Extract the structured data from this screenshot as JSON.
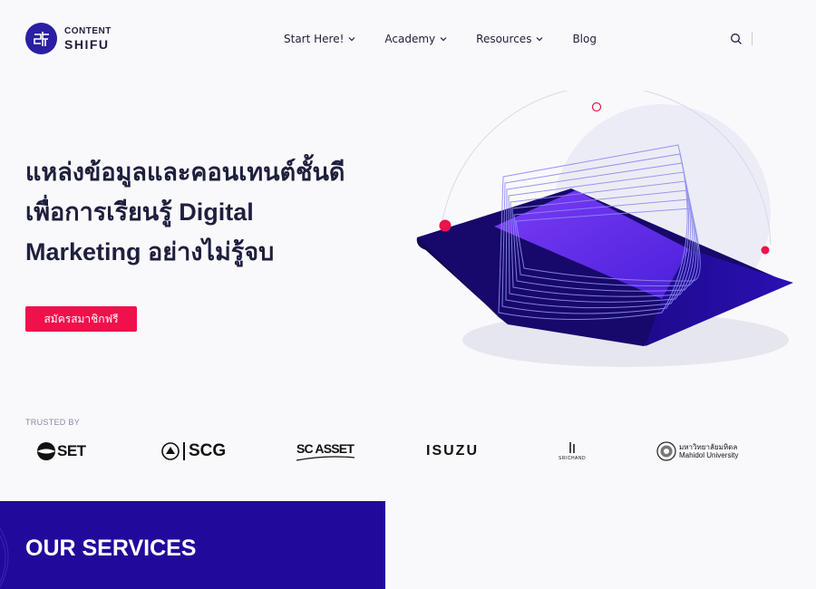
{
  "brand": {
    "logo_top": "CONTENT",
    "logo_bottom": "SHIFU",
    "icon": "content-shifu-logo-icon"
  },
  "nav": {
    "items": [
      {
        "label": "Start Here!",
        "has_dropdown": true
      },
      {
        "label": "Academy",
        "has_dropdown": true
      },
      {
        "label": "Resources",
        "has_dropdown": true
      },
      {
        "label": "Blog",
        "has_dropdown": false
      }
    ],
    "search_icon": "search-icon"
  },
  "hero": {
    "title_lines": [
      "แหล่งข้อมูลและคอนเทนต์ชั้นดี",
      "เพื่อการเรียนรู้ Digital",
      "Marketing อย่างไม่รู้จบ"
    ],
    "cta_label": "สมัครสมาชิกฟรี"
  },
  "trusted": {
    "label": "TRUSTED BY",
    "logos": [
      {
        "name": "SET",
        "text": "SET"
      },
      {
        "name": "SCG",
        "text": "SCG"
      },
      {
        "name": "SC ASSET",
        "text": "SC ASSET"
      },
      {
        "name": "ISUZU",
        "text": "ISUZU"
      },
      {
        "name": "SRICHAND",
        "text": "SRICHAND"
      },
      {
        "name": "Mahidol University",
        "text_th": "มหาวิทยาลัยมหิดล",
        "text_en": "Mahidol University"
      }
    ]
  },
  "services": {
    "title": "OUR SERVICES"
  },
  "colors": {
    "accent": "#f0104b",
    "brand_blue": "#21099b",
    "text": "#1f1f3d",
    "background": "#f9f9fc"
  }
}
